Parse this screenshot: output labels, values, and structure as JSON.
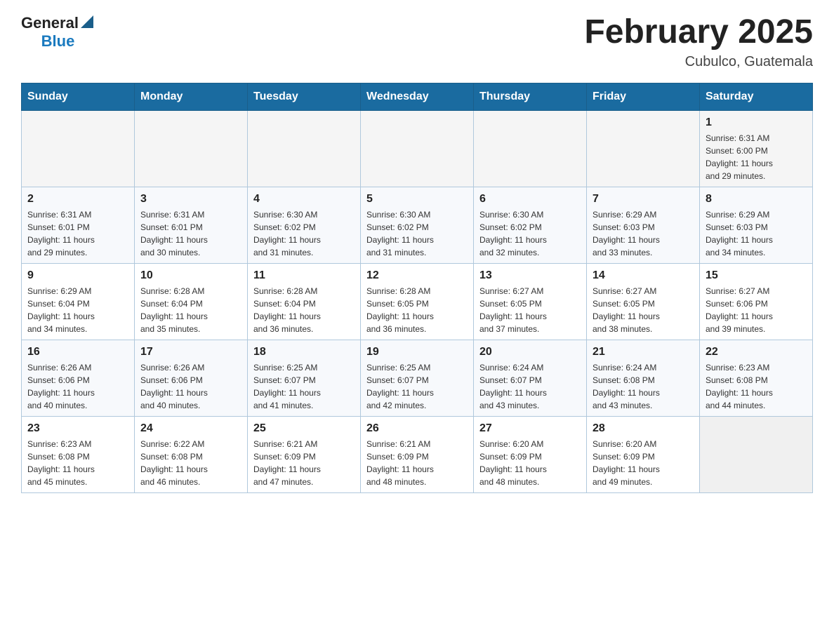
{
  "header": {
    "logo_general": "General",
    "logo_blue": "Blue",
    "month_title": "February 2025",
    "location": "Cubulco, Guatemala"
  },
  "days_of_week": [
    "Sunday",
    "Monday",
    "Tuesday",
    "Wednesday",
    "Thursday",
    "Friday",
    "Saturday"
  ],
  "weeks": [
    [
      {
        "day": "",
        "info": ""
      },
      {
        "day": "",
        "info": ""
      },
      {
        "day": "",
        "info": ""
      },
      {
        "day": "",
        "info": ""
      },
      {
        "day": "",
        "info": ""
      },
      {
        "day": "",
        "info": ""
      },
      {
        "day": "1",
        "info": "Sunrise: 6:31 AM\nSunset: 6:00 PM\nDaylight: 11 hours\nand 29 minutes."
      }
    ],
    [
      {
        "day": "2",
        "info": "Sunrise: 6:31 AM\nSunset: 6:01 PM\nDaylight: 11 hours\nand 29 minutes."
      },
      {
        "day": "3",
        "info": "Sunrise: 6:31 AM\nSunset: 6:01 PM\nDaylight: 11 hours\nand 30 minutes."
      },
      {
        "day": "4",
        "info": "Sunrise: 6:30 AM\nSunset: 6:02 PM\nDaylight: 11 hours\nand 31 minutes."
      },
      {
        "day": "5",
        "info": "Sunrise: 6:30 AM\nSunset: 6:02 PM\nDaylight: 11 hours\nand 31 minutes."
      },
      {
        "day": "6",
        "info": "Sunrise: 6:30 AM\nSunset: 6:02 PM\nDaylight: 11 hours\nand 32 minutes."
      },
      {
        "day": "7",
        "info": "Sunrise: 6:29 AM\nSunset: 6:03 PM\nDaylight: 11 hours\nand 33 minutes."
      },
      {
        "day": "8",
        "info": "Sunrise: 6:29 AM\nSunset: 6:03 PM\nDaylight: 11 hours\nand 34 minutes."
      }
    ],
    [
      {
        "day": "9",
        "info": "Sunrise: 6:29 AM\nSunset: 6:04 PM\nDaylight: 11 hours\nand 34 minutes."
      },
      {
        "day": "10",
        "info": "Sunrise: 6:28 AM\nSunset: 6:04 PM\nDaylight: 11 hours\nand 35 minutes."
      },
      {
        "day": "11",
        "info": "Sunrise: 6:28 AM\nSunset: 6:04 PM\nDaylight: 11 hours\nand 36 minutes."
      },
      {
        "day": "12",
        "info": "Sunrise: 6:28 AM\nSunset: 6:05 PM\nDaylight: 11 hours\nand 36 minutes."
      },
      {
        "day": "13",
        "info": "Sunrise: 6:27 AM\nSunset: 6:05 PM\nDaylight: 11 hours\nand 37 minutes."
      },
      {
        "day": "14",
        "info": "Sunrise: 6:27 AM\nSunset: 6:05 PM\nDaylight: 11 hours\nand 38 minutes."
      },
      {
        "day": "15",
        "info": "Sunrise: 6:27 AM\nSunset: 6:06 PM\nDaylight: 11 hours\nand 39 minutes."
      }
    ],
    [
      {
        "day": "16",
        "info": "Sunrise: 6:26 AM\nSunset: 6:06 PM\nDaylight: 11 hours\nand 40 minutes."
      },
      {
        "day": "17",
        "info": "Sunrise: 6:26 AM\nSunset: 6:06 PM\nDaylight: 11 hours\nand 40 minutes."
      },
      {
        "day": "18",
        "info": "Sunrise: 6:25 AM\nSunset: 6:07 PM\nDaylight: 11 hours\nand 41 minutes."
      },
      {
        "day": "19",
        "info": "Sunrise: 6:25 AM\nSunset: 6:07 PM\nDaylight: 11 hours\nand 42 minutes."
      },
      {
        "day": "20",
        "info": "Sunrise: 6:24 AM\nSunset: 6:07 PM\nDaylight: 11 hours\nand 43 minutes."
      },
      {
        "day": "21",
        "info": "Sunrise: 6:24 AM\nSunset: 6:08 PM\nDaylight: 11 hours\nand 43 minutes."
      },
      {
        "day": "22",
        "info": "Sunrise: 6:23 AM\nSunset: 6:08 PM\nDaylight: 11 hours\nand 44 minutes."
      }
    ],
    [
      {
        "day": "23",
        "info": "Sunrise: 6:23 AM\nSunset: 6:08 PM\nDaylight: 11 hours\nand 45 minutes."
      },
      {
        "day": "24",
        "info": "Sunrise: 6:22 AM\nSunset: 6:08 PM\nDaylight: 11 hours\nand 46 minutes."
      },
      {
        "day": "25",
        "info": "Sunrise: 6:21 AM\nSunset: 6:09 PM\nDaylight: 11 hours\nand 47 minutes."
      },
      {
        "day": "26",
        "info": "Sunrise: 6:21 AM\nSunset: 6:09 PM\nDaylight: 11 hours\nand 48 minutes."
      },
      {
        "day": "27",
        "info": "Sunrise: 6:20 AM\nSunset: 6:09 PM\nDaylight: 11 hours\nand 48 minutes."
      },
      {
        "day": "28",
        "info": "Sunrise: 6:20 AM\nSunset: 6:09 PM\nDaylight: 11 hours\nand 49 minutes."
      },
      {
        "day": "",
        "info": ""
      }
    ]
  ]
}
